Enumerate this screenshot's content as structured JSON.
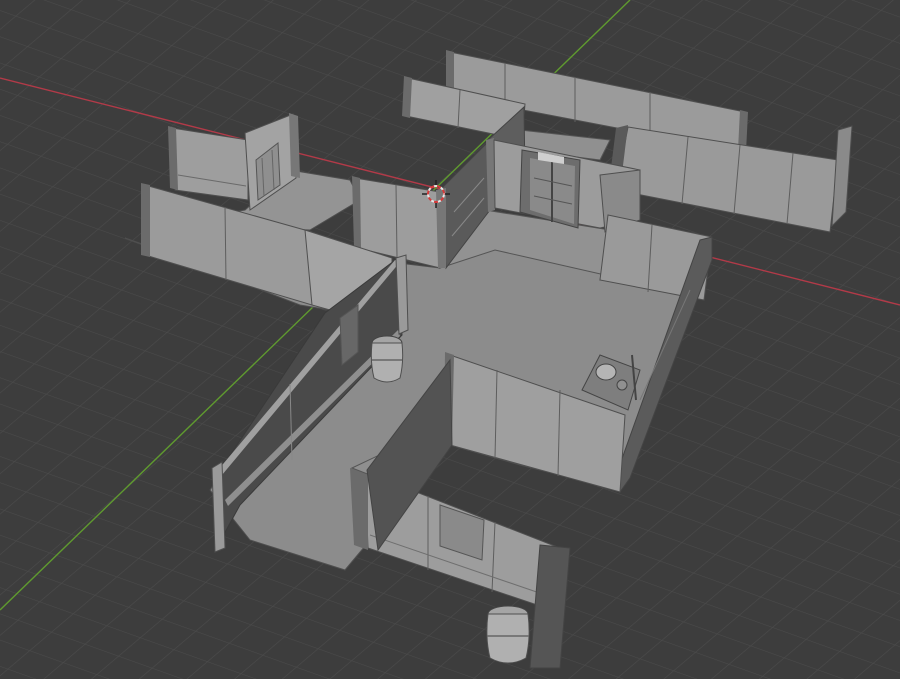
{
  "app": {
    "editor": "3D Viewport",
    "shading_mode": "solid"
  },
  "colors": {
    "background": "#3d3d3d",
    "grid_line": "#4a4a4a",
    "x_axis": "#b23a48",
    "y_axis": "#5f9a2f",
    "wall_light": "#9a9a9a",
    "wall_mid": "#878787",
    "wall_dark": "#5e5e5e",
    "floor": "#8c8c8c",
    "edge": "#4f4f4f"
  },
  "scene": {
    "objects": [
      "floor-main",
      "wall-north-long",
      "wall-north-short",
      "wall-east",
      "wall-west-back",
      "wall-south-left",
      "wall-center",
      "door-frame-west",
      "elevator-door",
      "railing-west",
      "room-south-east",
      "room-south",
      "barrel-center",
      "barrel-south",
      "console-machine"
    ]
  },
  "cursor_3d": {
    "icon": "3d-cursor-icon"
  }
}
